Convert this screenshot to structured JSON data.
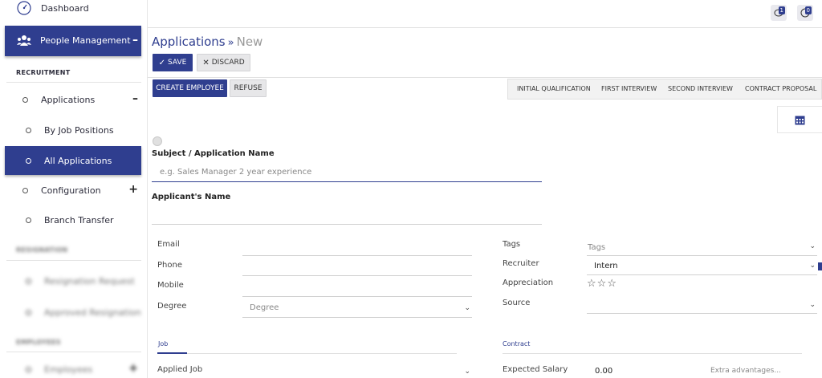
{
  "sidebar": {
    "dashboard": "Dashboard",
    "people_management": "People Management",
    "people_management_toggle": "–",
    "section_recruitment": "RECRUITMENT",
    "applications": "Applications",
    "applications_toggle": "–",
    "by_job_positions": "By Job Positions",
    "all_applications": "All Applications",
    "configuration": "Configuration",
    "configuration_toggle": "+",
    "branch_transfer": "Branch Transfer",
    "section_resignation": "RESIGNATION",
    "resignation_request": "Resignation Request",
    "approved_resignation": "Approved Resignation",
    "section_employees": "EMPLOYEES",
    "employees": "Employees",
    "employees_toggle": "+"
  },
  "topbar": {
    "messages_count": "1",
    "activities_count": "0"
  },
  "breadcrumb": {
    "parent": "Applications",
    "separator": "»",
    "current": "New"
  },
  "actions": {
    "save": "SAVE",
    "discard": "DISCARD",
    "create_employee": "CREATE EMPLOYEE",
    "refuse": "REFUSE"
  },
  "stages": [
    "INITIAL QUALIFICATION",
    "FIRST INTERVIEW",
    "SECOND INTERVIEW",
    "CONTRACT PROPOSAL"
  ],
  "form": {
    "subject_label": "Subject / Application Name",
    "subject_placeholder": "e.g. Sales Manager 2 year experience",
    "applicant_label": "Applicant's Name",
    "email_label": "Email",
    "phone_label": "Phone",
    "mobile_label": "Mobile",
    "degree_label": "Degree",
    "degree_placeholder": "Degree",
    "tags_label": "Tags",
    "tags_placeholder": "Tags",
    "recruiter_label": "Recruiter",
    "recruiter_value": "Intern",
    "appreciation_label": "Appreciation",
    "appreciation_stars": 0,
    "source_label": "Source",
    "job_tab": "Job",
    "contract_tab": "Contract",
    "applied_job_label": "Applied Job",
    "expected_salary_label": "Expected Salary",
    "expected_salary_value": "0.00",
    "extra_advantages_placeholder": "Extra advantages..."
  },
  "colors": {
    "primary": "#2f3e8f",
    "sidebar_active": "#2f3e8f"
  }
}
